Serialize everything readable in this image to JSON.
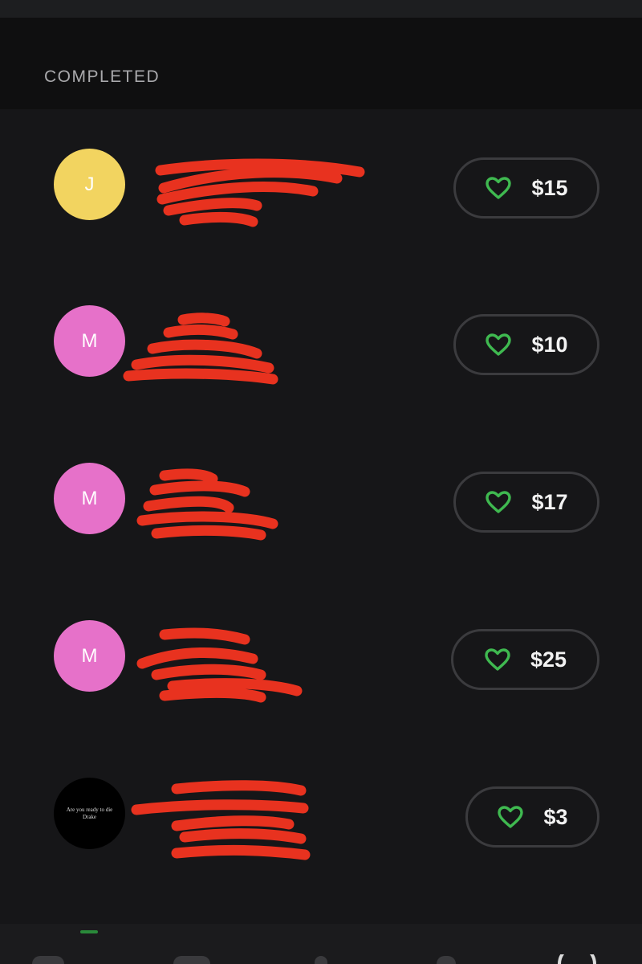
{
  "section": {
    "title": "COMPLETED"
  },
  "accent_color": "#3fb950",
  "redaction_color": "#e8321f",
  "rows": [
    {
      "avatar": {
        "initial": "J",
        "color": "#f2d460"
      },
      "tip": "$15"
    },
    {
      "avatar": {
        "initial": "M",
        "color": "#e671c9"
      },
      "tip": "$10"
    },
    {
      "avatar": {
        "initial": "M",
        "color": "#e671c9"
      },
      "tip": "$17"
    },
    {
      "avatar": {
        "initial": "M",
        "color": "#e671c9"
      },
      "tip": "$25"
    },
    {
      "avatar": {
        "image_text_1": "Are you ready to die",
        "image_text_2": "Drake"
      },
      "tip": "$3"
    }
  ],
  "icons": {
    "tip": "heart-outline-icon",
    "nav": [
      "home-icon",
      "card-icon",
      "activity-icon",
      "search-icon",
      "profile-icon"
    ]
  }
}
